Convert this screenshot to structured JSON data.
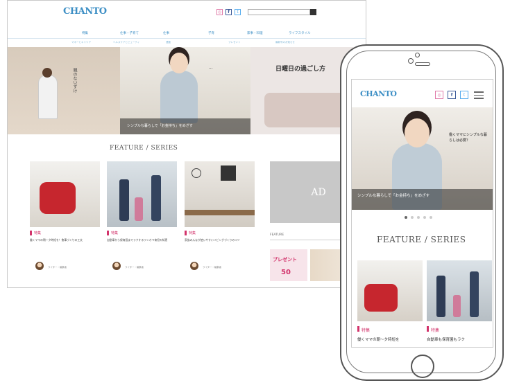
{
  "desktop": {
    "logo": "CHANTO",
    "nav": [
      "特集",
      "仕事・子育て",
      "仕事",
      "子育",
      "家事・料理",
      "ライフスタイル"
    ],
    "subnav": [
      "マネーとキャリア",
      "ヘルスケアとビューティ",
      "連載",
      "プレゼント",
      "最新号のお知らせ"
    ],
    "slide_left_text": "親のないずけ",
    "slide_caption": "シンプルな暮らしで「お金持ち」をめざす",
    "slide_right_text": "日曜日の過ごし方",
    "section_title": "FEATURE / SERIES",
    "cards": [
      {
        "category": "特集",
        "title": "働くママの朝〜夕時短を！食事づくりの工夫",
        "author": "ライター・編集者"
      },
      {
        "category": "特集",
        "title": "自動車から保育園までラクするワンオペ育児の知恵",
        "author": "ライター・編集者"
      },
      {
        "category": "特集",
        "title": "家族みんなが使いやすいリビングづくりのコツ",
        "author": "ライター・編集者"
      }
    ],
    "ad_label": "AD",
    "feature_label": "FEATURE",
    "present_text": "プレゼント"
  },
  "phone": {
    "logo": "CHANTO",
    "slide_text": "働くママにシンプルな暮らしは必要？",
    "slide_caption": "シンプルな暮らしで「お金持ち」をめざす",
    "section_title": "FEATURE / SERIES",
    "cards": [
      {
        "category": "特集",
        "title": "働くママの朝〜夕時短を"
      },
      {
        "category": "特集",
        "title": "自動車も保育園もラク"
      }
    ]
  },
  "colors": {
    "brand": "#3d8fc5",
    "accent": "#d2336b",
    "pink_icon": "#e07aa8",
    "facebook": "#3b5998",
    "twitter": "#55acee"
  },
  "icons": [
    "instagram-icon",
    "facebook-icon",
    "twitter-icon",
    "search-icon",
    "hamburger-menu-icon"
  ]
}
